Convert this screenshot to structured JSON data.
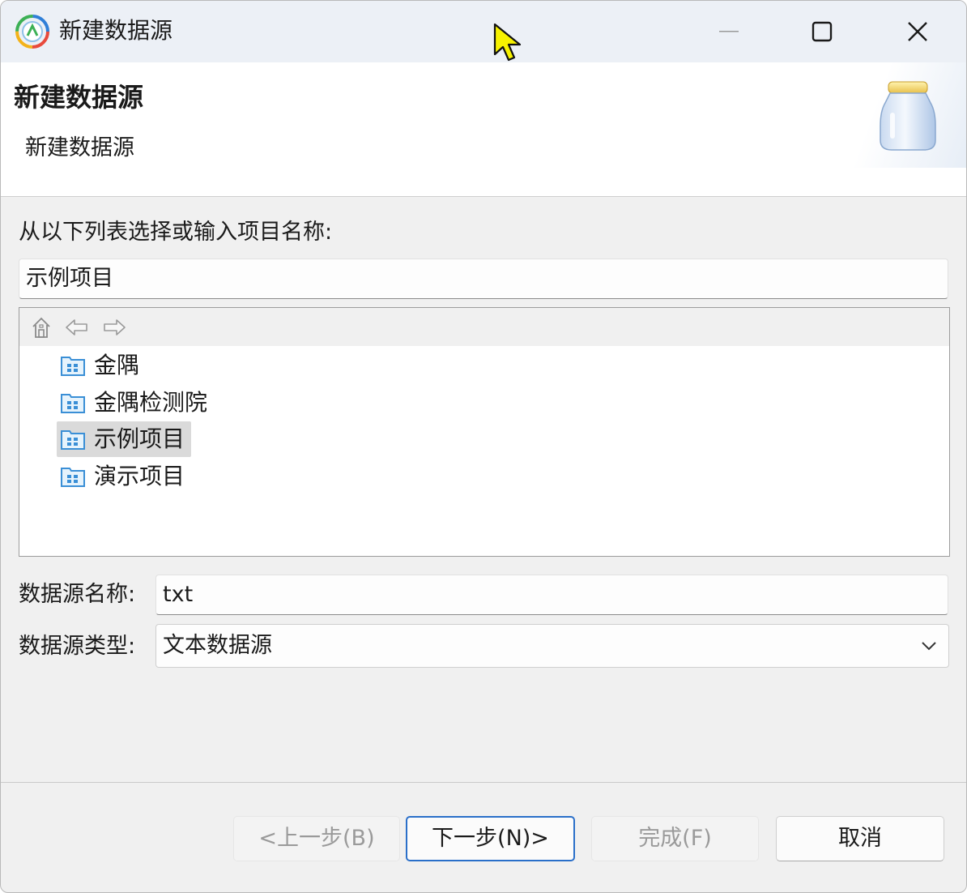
{
  "window": {
    "title": "新建数据源",
    "icons": {
      "app": "app-logo-icon",
      "minimize": "minimize-icon",
      "maximize": "maximize-icon",
      "close": "close-icon"
    }
  },
  "banner": {
    "title": "新建数据源",
    "subtitle": "新建数据源",
    "icon": "database-jar-icon"
  },
  "project": {
    "label": "从以下列表选择或输入项目名称:",
    "value": "示例项目"
  },
  "tree": {
    "toolbar": [
      "home-icon",
      "back-arrow-icon",
      "forward-arrow-icon"
    ],
    "items": [
      {
        "label": "金隅",
        "selected": false
      },
      {
        "label": "金隅检测院",
        "selected": false
      },
      {
        "label": "示例项目",
        "selected": true
      },
      {
        "label": "演示项目",
        "selected": false
      }
    ]
  },
  "datasource": {
    "name_label": "数据源名称:",
    "name_value": "txt",
    "type_label": "数据源类型:",
    "type_value": "文本数据源"
  },
  "buttons": {
    "prev": "<上一步(B)",
    "next": "下一步(N)>",
    "finish": "完成(F)",
    "cancel": "取消"
  },
  "colors": {
    "accent": "#2a6fc9",
    "selection": "#dadada",
    "folder_icon": "#3a8fd6",
    "cursor": "#f7f200"
  }
}
